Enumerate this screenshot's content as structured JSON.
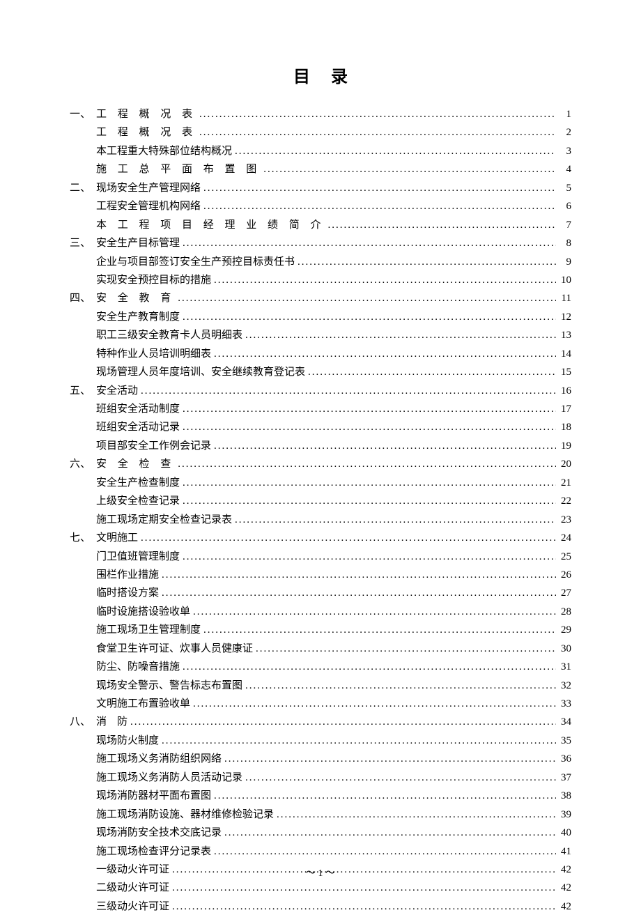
{
  "title": "目录",
  "footer": "～ 1 ～",
  "entries": [
    {
      "marker": "一、",
      "label": "工 程 概 况 表",
      "spaced": true,
      "page": "1",
      "sub": false
    },
    {
      "marker": "",
      "label": "工 程 概 况 表",
      "spaced": true,
      "page": "2",
      "sub": true
    },
    {
      "marker": "",
      "label": "本工程重大特殊部位结构概况",
      "spaced": false,
      "page": "3",
      "sub": true
    },
    {
      "marker": "",
      "label": "施 工 总 平 面 布 置 图",
      "spaced": true,
      "page": "4",
      "sub": true
    },
    {
      "marker": "二、",
      "label": "现场安全生产管理网络",
      "spaced": false,
      "page": "5",
      "sub": false
    },
    {
      "marker": "",
      "label": "工程安全管理机构网络",
      "spaced": false,
      "page": "6",
      "sub": true
    },
    {
      "marker": "",
      "label": "本 工 程 项 目 经 理 业 绩 简 介",
      "spaced": true,
      "page": "7",
      "sub": true
    },
    {
      "marker": "三、",
      "label": "安全生产目标管理",
      "spaced": false,
      "page": "8",
      "sub": false
    },
    {
      "marker": "",
      "label": "企业与项目部签订安全生产预控目标责任书",
      "spaced": false,
      "page": "9",
      "sub": true
    },
    {
      "marker": "",
      "label": "实现安全预控目标的措施",
      "spaced": false,
      "page": "10",
      "sub": true
    },
    {
      "marker": "四、",
      "label": " 安 全 教 育",
      "spaced": true,
      "page": "11",
      "sub": false
    },
    {
      "marker": "",
      "label": "安全生产教育制度",
      "spaced": false,
      "page": "12",
      "sub": true
    },
    {
      "marker": "",
      "label": "职工三级安全教育卡人员明细表",
      "spaced": false,
      "page": "13",
      "sub": true
    },
    {
      "marker": "",
      "label": "特种作业人员培训明细表",
      "spaced": false,
      "page": "14",
      "sub": true
    },
    {
      "marker": "",
      "label": "现场管理人员年度培训、安全继续教育登记表",
      "spaced": false,
      "page": "15",
      "sub": true
    },
    {
      "marker": "五、",
      "label": "安全活动",
      "spaced": false,
      "page": "16",
      "sub": false
    },
    {
      "marker": "",
      "label": "班组安全活动制度",
      "spaced": false,
      "page": "17",
      "sub": true
    },
    {
      "marker": "",
      "label": "班组安全活动记录",
      "spaced": false,
      "page": "18",
      "sub": true
    },
    {
      "marker": "",
      "label": "项目部安全工作例会记录",
      "spaced": false,
      "page": "19",
      "sub": true
    },
    {
      "marker": "六、",
      "label": "安 全 检 查",
      "spaced": true,
      "page": "20",
      "sub": false
    },
    {
      "marker": "",
      "label": "安全生产检查制度",
      "spaced": false,
      "page": "21",
      "sub": true
    },
    {
      "marker": "",
      "label": "上级安全检查记录",
      "spaced": false,
      "page": "22",
      "sub": true
    },
    {
      "marker": "",
      "label": "施工现场定期安全检查记录表",
      "spaced": false,
      "page": "23",
      "sub": true
    },
    {
      "marker": "七、",
      "label": "文明施工",
      "spaced": false,
      "page": "24",
      "sub": false
    },
    {
      "marker": "",
      "label": "门卫值班管理制度",
      "spaced": false,
      "page": "25",
      "sub": true
    },
    {
      "marker": "",
      "label": "围栏作业措施",
      "spaced": false,
      "page": "26",
      "sub": true
    },
    {
      "marker": "",
      "label": "临时搭设方案",
      "spaced": false,
      "page": "27",
      "sub": true
    },
    {
      "marker": "",
      "label": "临时设施搭设验收单",
      "spaced": false,
      "page": "28",
      "sub": true
    },
    {
      "marker": "",
      "label": "施工现场卫生管理制度",
      "spaced": false,
      "page": "29",
      "sub": true
    },
    {
      "marker": "",
      "label": "食堂卫生许可证、炊事人员健康证",
      "spaced": false,
      "page": "30",
      "sub": true
    },
    {
      "marker": "",
      "label": "防尘、防噪音措施",
      "spaced": false,
      "page": "31",
      "sub": true
    },
    {
      "marker": "",
      "label": "现场安全警示、警告标志布置图",
      "spaced": false,
      "page": "32",
      "sub": true
    },
    {
      "marker": "",
      "label": "文明施工布置验收单",
      "spaced": false,
      "page": "33",
      "sub": true
    },
    {
      "marker": "八、",
      "label": "消　防",
      "spaced": false,
      "page": "34",
      "sub": false
    },
    {
      "marker": "",
      "label": "现场防火制度",
      "spaced": false,
      "page": "35",
      "sub": true
    },
    {
      "marker": "",
      "label": "施工现场义务消防组织网络",
      "spaced": false,
      "page": "36",
      "sub": true
    },
    {
      "marker": "",
      "label": "施工现场义务消防人员活动记录",
      "spaced": false,
      "page": "37",
      "sub": true
    },
    {
      "marker": "",
      "label": "现场消防器材平面布置图",
      "spaced": false,
      "page": "38",
      "sub": true
    },
    {
      "marker": "",
      "label": "施工现场消防设施、器材维修检验记录",
      "spaced": false,
      "page": "39",
      "sub": true
    },
    {
      "marker": "",
      "label": "现场消防安全技术交底记录",
      "spaced": false,
      "page": "40",
      "sub": true
    },
    {
      "marker": "",
      "label": "施工现场检查评分记录表",
      "spaced": false,
      "page": "41",
      "sub": true
    },
    {
      "marker": "",
      "label": "一级动火许可证",
      "spaced": false,
      "page": "42",
      "sub": true
    },
    {
      "marker": "",
      "label": "二级动火许可证",
      "spaced": false,
      "page": "42",
      "sub": true
    },
    {
      "marker": "",
      "label": "三级动火许可证",
      "spaced": false,
      "page": "42",
      "sub": true
    }
  ]
}
